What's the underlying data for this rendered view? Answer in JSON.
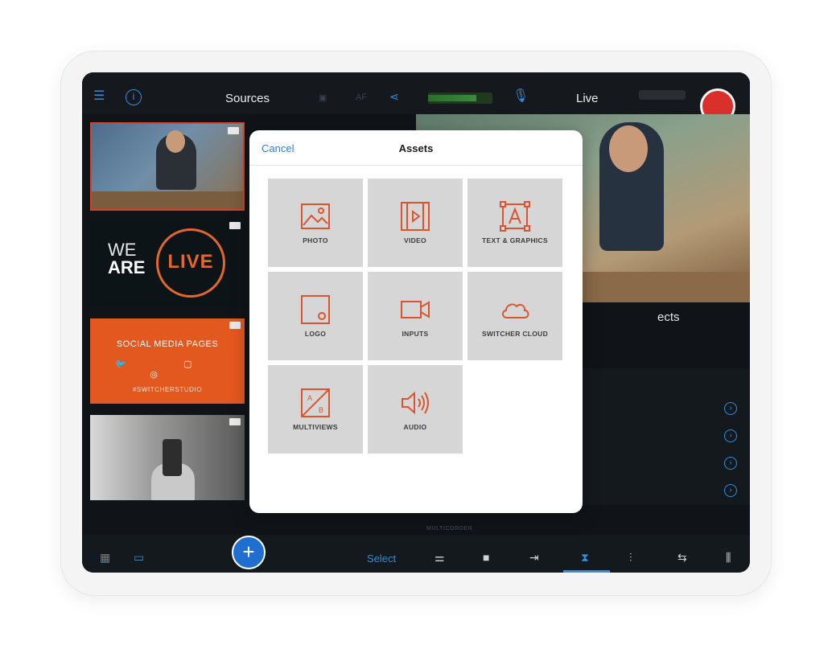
{
  "topbar": {
    "menu_icon": "hamburger-icon",
    "info_icon": "info-icon",
    "sources_title": "Sources",
    "camera_icon": "camera-icon",
    "af_label": "AF",
    "share_icon": "share-icon",
    "mic_icon": "microphone-icon",
    "live_title": "Live",
    "record_icon": "record-icon"
  },
  "sources": {
    "tile2_we": "WE",
    "tile2_are": "ARE",
    "tile2_live": "LIVE",
    "tile3_title": "SOCIAL MEDIA PAGES",
    "tile3_tag": "#SWITCHERSTUDIO"
  },
  "program": {
    "effects_label": "ects"
  },
  "modal": {
    "cancel_label": "Cancel",
    "title": "Assets",
    "items": [
      {
        "label": "PHOTO",
        "icon": "photo-icon"
      },
      {
        "label": "VIDEO",
        "icon": "video-icon"
      },
      {
        "label": "TEXT & GRAPHICS",
        "icon": "text-graphics-icon"
      },
      {
        "label": "LOGO",
        "icon": "logo-icon"
      },
      {
        "label": "INPUTS",
        "icon": "inputs-icon"
      },
      {
        "label": "SWITCHER CLOUD",
        "icon": "cloud-icon"
      },
      {
        "label": "MULTIVIEWS",
        "icon": "multiviews-icon"
      },
      {
        "label": "AUDIO",
        "icon": "audio-icon"
      }
    ]
  },
  "bottombar": {
    "multicorder_label": "MULTICORDER",
    "select_label": "Select",
    "add_icon": "plus-icon"
  },
  "colors": {
    "accent": "#2f8fe0",
    "record": "#d9302b",
    "asset_icon": "#d9552f",
    "asset_tile": "#d6d6d7"
  }
}
